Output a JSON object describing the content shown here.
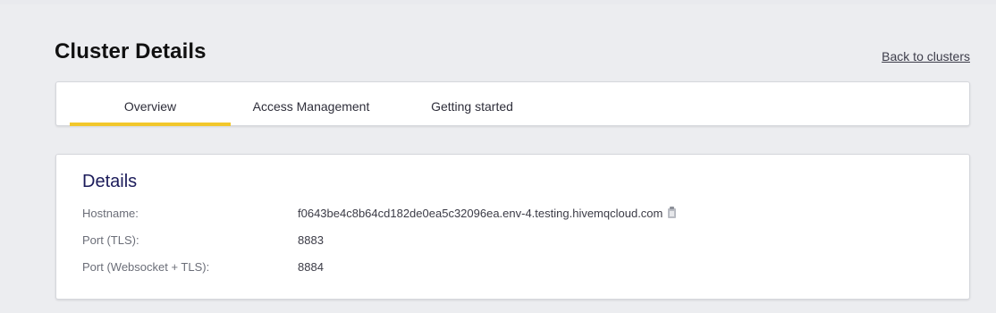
{
  "header": {
    "title": "Cluster Details",
    "back_link": "Back to clusters"
  },
  "tabs": [
    {
      "label": "Overview",
      "active": true
    },
    {
      "label": "Access Management",
      "active": false
    },
    {
      "label": "Getting started",
      "active": false
    }
  ],
  "details": {
    "heading": "Details",
    "rows": [
      {
        "label": "Hostname:",
        "value": "f0643be4c8b64cd182de0ea5c32096ea.env-4.testing.hivemqcloud.com"
      },
      {
        "label": "Port (TLS):",
        "value": "8883"
      },
      {
        "label": "Port (Websocket + TLS):",
        "value": "8884"
      }
    ],
    "copy_icon": "clipboard-icon"
  },
  "colors": {
    "accent": "#f2c72b",
    "heading": "#1b1b5a",
    "background": "#ecedf0"
  }
}
